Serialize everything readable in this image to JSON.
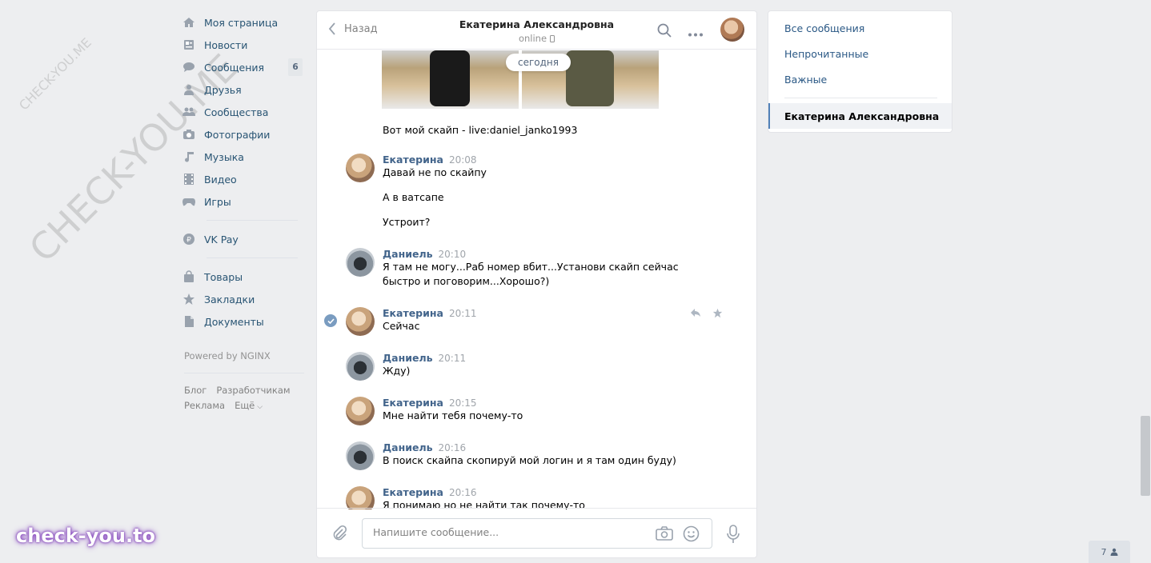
{
  "watermarks": {
    "small": "CHECK-YOU.ME",
    "large": "CHECK-YOU.ME",
    "brand": "check-you.to"
  },
  "leftmenu": {
    "items": [
      {
        "label": "Моя страница",
        "icon": "home-icon"
      },
      {
        "label": "Новости",
        "icon": "news-icon"
      },
      {
        "label": "Сообщения",
        "icon": "messages-icon",
        "count": "6"
      },
      {
        "label": "Друзья",
        "icon": "friends-icon"
      },
      {
        "label": "Сообщества",
        "icon": "communities-icon"
      },
      {
        "label": "Фотографии",
        "icon": "camera-icon"
      },
      {
        "label": "Музыка",
        "icon": "music-icon"
      },
      {
        "label": "Видео",
        "icon": "video-icon"
      },
      {
        "label": "Игры",
        "icon": "games-icon"
      },
      {
        "label": "VK Pay",
        "icon": "vkpay-icon"
      },
      {
        "label": "Товары",
        "icon": "bag-icon"
      },
      {
        "label": "Закладки",
        "icon": "star-icon"
      },
      {
        "label": "Документы",
        "icon": "document-icon"
      }
    ],
    "powered": "Powered by NGINX",
    "links": [
      "Блог",
      "Разработчикам",
      "Реклама",
      "Ещё"
    ]
  },
  "chat": {
    "back_label": "Назад",
    "peer_name": "Екатерина Александровна",
    "peer_status": "online",
    "date_pill": "сегодня",
    "messages": [
      {
        "lines": [
          "Вот мой скайп - live:daniel_janko1993"
        ]
      },
      {
        "author": "Екатерина",
        "time": "20:08",
        "lines": [
          "Давай не по скайпу",
          "А в ватсапе",
          "Устроит?"
        ]
      },
      {
        "author": "Даниель",
        "time": "20:10",
        "lines": [
          "Я там не могу...Раб номер вбит...Установи скайп сейчас",
          "быстро и поговорим...Хорошо?)"
        ]
      },
      {
        "author": "Екатерина",
        "time": "20:11",
        "lines": [
          "Сейчас"
        ]
      },
      {
        "author": "Даниель",
        "time": "20:11",
        "lines": [
          "Жду)"
        ]
      },
      {
        "author": "Екатерина",
        "time": "20:15",
        "lines": [
          "Мне найти тебя почему-то"
        ]
      },
      {
        "author": "Даниель",
        "time": "20:16",
        "lines": [
          "В поиск скайпа скопируй мой логин и я там один буду)"
        ]
      },
      {
        "author": "Екатерина",
        "time": "20:16",
        "lines": [
          "Я понимаю но не найти так почему-то"
        ]
      }
    ],
    "composer_placeholder": "Напишите сообщение..."
  },
  "rightpanel": {
    "items": [
      "Все сообщения",
      "Непрочитанные",
      "Важные"
    ],
    "active_chat": "Екатерина Александровна"
  },
  "online_count": "7",
  "colors": {
    "link": "#2a5885",
    "author": "#42648b",
    "accent": "#5181b8",
    "bg": "#edeef0"
  }
}
